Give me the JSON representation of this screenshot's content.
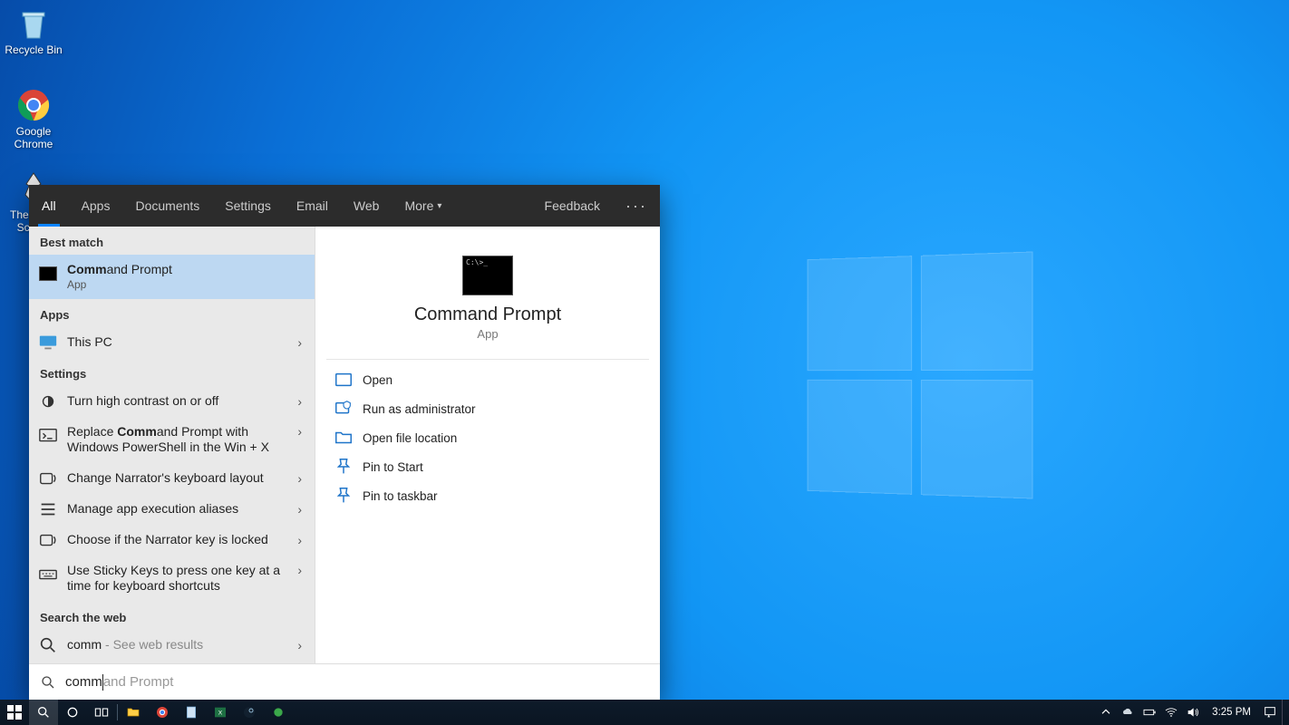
{
  "desktop": {
    "icons": [
      {
        "label": "Recycle Bin"
      },
      {
        "label": "Google Chrome"
      },
      {
        "label": "The Elder Scro…"
      }
    ]
  },
  "search": {
    "tabs": {
      "all": "All",
      "apps": "Apps",
      "documents": "Documents",
      "settings": "Settings",
      "email": "Email",
      "web": "Web",
      "more": "More",
      "feedback": "Feedback"
    },
    "sections": {
      "best_match": "Best match",
      "apps": "Apps",
      "settings": "Settings",
      "web": "Search the web"
    },
    "best_match": {
      "prefix": "Comm",
      "suffix": "and Prompt",
      "type": "App"
    },
    "apps_list": [
      {
        "label": "This PC"
      }
    ],
    "settings_list": [
      {
        "label": "Turn high contrast on or off"
      },
      {
        "prefix": "Replace ",
        "bold": "Comm",
        "suffix": "and Prompt with Windows PowerShell in the Win + X"
      },
      {
        "label": "Change Narrator's keyboard layout"
      },
      {
        "label": "Manage app execution aliases"
      },
      {
        "label": "Choose if the Narrator key is locked"
      },
      {
        "label": "Use Sticky Keys to press one key at a time for keyboard shortcuts"
      }
    ],
    "web_result": {
      "query": "comm",
      "hint": " - See web results"
    },
    "preview": {
      "title": "Command Prompt",
      "type": "App",
      "actions": {
        "open": "Open",
        "run_admin": "Run as administrator",
        "open_loc": "Open file location",
        "pin_start": "Pin to Start",
        "pin_taskbar": "Pin to taskbar"
      }
    },
    "input": {
      "typed": "comm",
      "ghost": "and Prompt"
    }
  },
  "taskbar": {
    "time": "3:25 PM"
  }
}
